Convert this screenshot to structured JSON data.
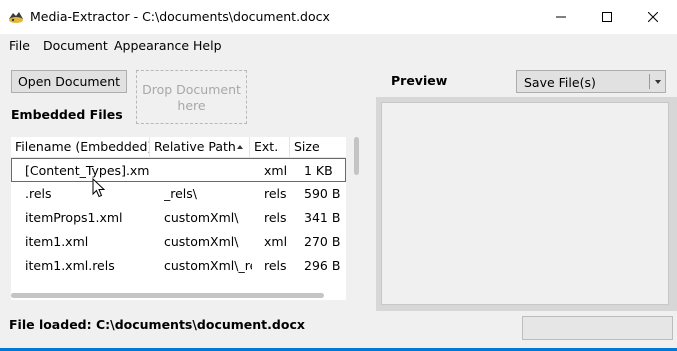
{
  "window": {
    "title": "Media-Extractor - C:\\documents\\document.docx",
    "icons": {
      "app": "app-icon",
      "minimize": "minimize-icon",
      "maximize": "maximize-icon",
      "close": "close-icon"
    }
  },
  "menu": [
    "File",
    "Document",
    "Appearance",
    "Help"
  ],
  "toolbar": {
    "open_label": "Open Document",
    "drop_line1": "Drop Document",
    "drop_line2": "here"
  },
  "files": {
    "section_label": "Embedded Files",
    "columns": [
      "Filename (Embedded)",
      "Relative Path",
      "Ext.",
      "Size"
    ],
    "sorted_column": "Relative Path",
    "rows": [
      {
        "filename": "[Content_Types].xml",
        "path": "",
        "ext": "xml",
        "size": "1 KB"
      },
      {
        "filename": ".rels",
        "path": "_rels\\",
        "ext": "rels",
        "size": "590 B"
      },
      {
        "filename": "itemProps1.xml",
        "path": "customXml\\",
        "ext": "rels",
        "size": "341 B"
      },
      {
        "filename": "item1.xml",
        "path": "customXml\\",
        "ext": "xml",
        "size": "270 B"
      },
      {
        "filename": "item1.xml.rels",
        "path": "customXml\\_rels\\",
        "ext": "rels",
        "size": "296 B"
      }
    ],
    "selected_row": 0
  },
  "preview": {
    "label": "Preview",
    "save_option": "Save File(s)"
  },
  "status": {
    "text": "File loaded: C:\\documents\\document.docx"
  },
  "colors": {
    "accent": "#0078d7",
    "panel": "#f0f0f0"
  }
}
